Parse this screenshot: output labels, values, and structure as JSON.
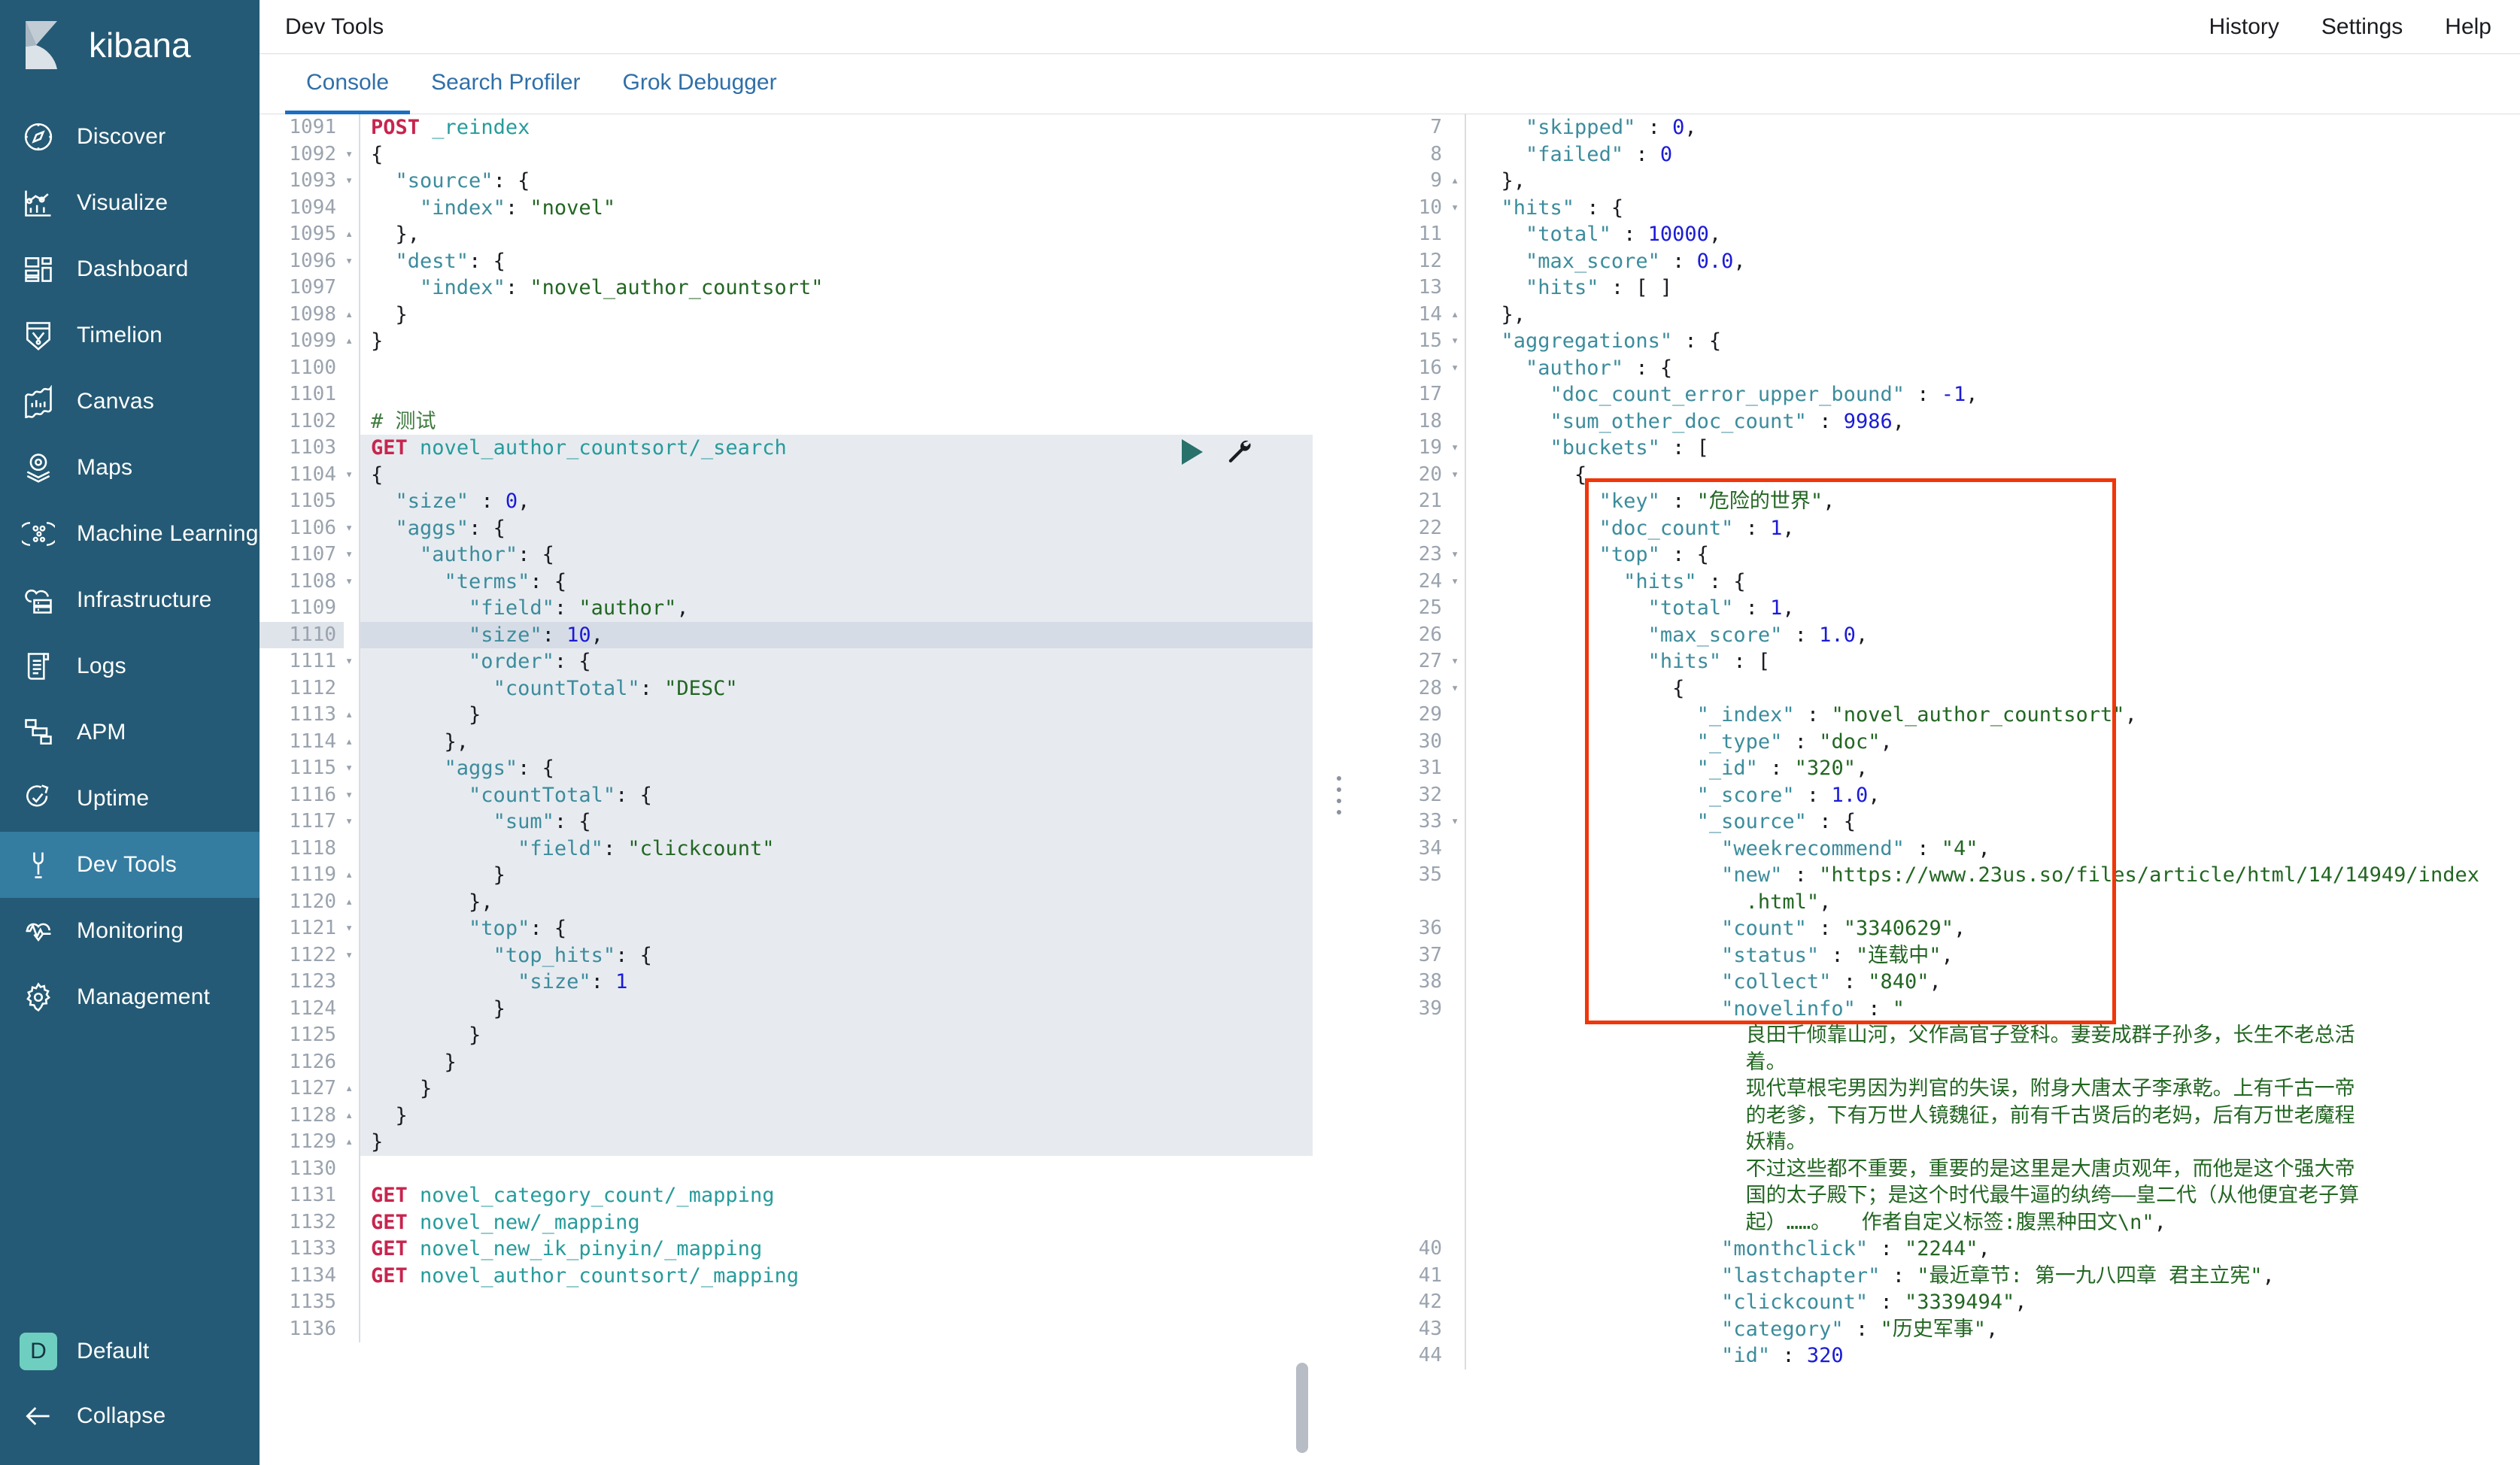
{
  "app": {
    "brand": "kibana",
    "page_title": "Dev Tools"
  },
  "topbar": {
    "links": [
      "History",
      "Settings",
      "Help"
    ]
  },
  "tabs": [
    {
      "label": "Console",
      "active": true
    },
    {
      "label": "Search Profiler",
      "active": false
    },
    {
      "label": "Grok Debugger",
      "active": false
    }
  ],
  "sidebar": {
    "items": [
      {
        "label": "Discover",
        "icon": "compass-icon",
        "active": false
      },
      {
        "label": "Visualize",
        "icon": "bar-chart-icon",
        "active": false
      },
      {
        "label": "Dashboard",
        "icon": "dashboard-icon",
        "active": false
      },
      {
        "label": "Timelion",
        "icon": "timelion-icon",
        "active": false
      },
      {
        "label": "Canvas",
        "icon": "canvas-icon",
        "active": false
      },
      {
        "label": "Maps",
        "icon": "map-pin-icon",
        "active": false
      },
      {
        "label": "Machine Learning",
        "icon": "machine-learning-icon",
        "active": false
      },
      {
        "label": "Infrastructure",
        "icon": "infrastructure-icon",
        "active": false
      },
      {
        "label": "Logs",
        "icon": "logs-icon",
        "active": false
      },
      {
        "label": "APM",
        "icon": "apm-icon",
        "active": false
      },
      {
        "label": "Uptime",
        "icon": "uptime-icon",
        "active": false
      },
      {
        "label": "Dev Tools",
        "icon": "wrench-icon",
        "active": true
      },
      {
        "label": "Monitoring",
        "icon": "heartbeat-icon",
        "active": false
      },
      {
        "label": "Management",
        "icon": "gear-icon",
        "active": false
      }
    ],
    "space": {
      "initial": "D",
      "label": "Default"
    },
    "collapse": {
      "label": "Collapse",
      "icon": "arrow-left-icon"
    }
  },
  "colors": {
    "sidebar_bg": "#245a75",
    "sidebar_active": "#357ca1",
    "tab_active": "#1b6ec2",
    "accent_link": "#2f6fa8",
    "avatar": "#6ecfc0",
    "annotation": "#f0360a",
    "method": "#c7254e",
    "url": "#279b9b",
    "key": "#3c8c9c",
    "string": "#226622",
    "number": "#1b1bd6",
    "comment": "#3f7a3f"
  },
  "editor": {
    "first_line_number": 1091,
    "cursor_line": 1110,
    "lines": [
      {
        "n": 1091,
        "fold": "",
        "hl": false,
        "html": "<span class=\"m\">POST</span> <span class=\"u\">_reindex</span>"
      },
      {
        "n": 1092,
        "fold": "▾",
        "hl": false,
        "html": "<span class=\"p\">{</span>"
      },
      {
        "n": 1093,
        "fold": "▾",
        "hl": false,
        "html": "  <span class=\"k\">\"source\"</span><span class=\"p\">: {</span>"
      },
      {
        "n": 1094,
        "fold": "",
        "hl": false,
        "html": "    <span class=\"k\">\"index\"</span><span class=\"p\">: </span><span class=\"s\">\"novel\"</span>"
      },
      {
        "n": 1095,
        "fold": "▴",
        "hl": false,
        "html": "  <span class=\"p\">},</span>"
      },
      {
        "n": 1096,
        "fold": "▾",
        "hl": false,
        "html": "  <span class=\"k\">\"dest\"</span><span class=\"p\">: {</span>"
      },
      {
        "n": 1097,
        "fold": "",
        "hl": false,
        "html": "    <span class=\"k\">\"index\"</span><span class=\"p\">: </span><span class=\"s\">\"novel_author_countsort\"</span>"
      },
      {
        "n": 1098,
        "fold": "▴",
        "hl": false,
        "html": "  <span class=\"p\">}</span>"
      },
      {
        "n": 1099,
        "fold": "▴",
        "hl": false,
        "html": "<span class=\"p\">}</span>"
      },
      {
        "n": 1100,
        "fold": "",
        "hl": false,
        "html": ""
      },
      {
        "n": 1101,
        "fold": "",
        "hl": false,
        "html": ""
      },
      {
        "n": 1102,
        "fold": "",
        "hl": false,
        "html": "<span class=\"cm\"># 测试</span>"
      },
      {
        "n": 1103,
        "fold": "",
        "hl": true,
        "html": "<span class=\"m\">GET</span> <span class=\"u\">novel_author_countsort/_search</span>"
      },
      {
        "n": 1104,
        "fold": "▾",
        "hl": true,
        "html": "<span class=\"p\">{</span>"
      },
      {
        "n": 1105,
        "fold": "",
        "hl": true,
        "html": "  <span class=\"k\">\"size\"</span> <span class=\"p\">: </span><span class=\"n\">0</span><span class=\"p\">,</span>"
      },
      {
        "n": 1106,
        "fold": "▾",
        "hl": true,
        "html": "  <span class=\"k\">\"aggs\"</span><span class=\"p\">: {</span>"
      },
      {
        "n": 1107,
        "fold": "▾",
        "hl": true,
        "html": "    <span class=\"k\">\"author\"</span><span class=\"p\">: {</span>"
      },
      {
        "n": 1108,
        "fold": "▾",
        "hl": true,
        "html": "      <span class=\"k\">\"terms\"</span><span class=\"p\">: {</span>"
      },
      {
        "n": 1109,
        "fold": "",
        "hl": true,
        "html": "        <span class=\"k\">\"field\"</span><span class=\"p\">: </span><span class=\"s\">\"author\"</span><span class=\"p\">,</span>"
      },
      {
        "n": 1110,
        "fold": "",
        "hl": true,
        "cursor": true,
        "html": "        <span class=\"k\">\"size\"</span><span class=\"p\">: </span><span class=\"n\">10</span><span class=\"p\">,</span>"
      },
      {
        "n": 1111,
        "fold": "▾",
        "hl": true,
        "html": "        <span class=\"k\">\"order\"</span><span class=\"p\">: {</span>"
      },
      {
        "n": 1112,
        "fold": "",
        "hl": true,
        "html": "          <span class=\"k\">\"countTotal\"</span><span class=\"p\">: </span><span class=\"s\">\"DESC\"</span>"
      },
      {
        "n": 1113,
        "fold": "▴",
        "hl": true,
        "html": "        <span class=\"p\">}</span>"
      },
      {
        "n": 1114,
        "fold": "▴",
        "hl": true,
        "html": "      <span class=\"p\">},</span>"
      },
      {
        "n": 1115,
        "fold": "▾",
        "hl": true,
        "html": "      <span class=\"k\">\"aggs\"</span><span class=\"p\">: {</span>"
      },
      {
        "n": 1116,
        "fold": "▾",
        "hl": true,
        "html": "        <span class=\"k\">\"countTotal\"</span><span class=\"p\">: {</span>"
      },
      {
        "n": 1117,
        "fold": "▾",
        "hl": true,
        "html": "          <span class=\"k\">\"sum\"</span><span class=\"p\">: {</span>"
      },
      {
        "n": 1118,
        "fold": "",
        "hl": true,
        "html": "            <span class=\"k\">\"field\"</span><span class=\"p\">: </span><span class=\"s\">\"clickcount\"</span>"
      },
      {
        "n": 1119,
        "fold": "▴",
        "hl": true,
        "html": "          <span class=\"p\">}</span>"
      },
      {
        "n": 1120,
        "fold": "▴",
        "hl": true,
        "html": "        <span class=\"p\">},</span>"
      },
      {
        "n": 1121,
        "fold": "▾",
        "hl": true,
        "html": "        <span class=\"k\">\"top\"</span><span class=\"p\">: {</span>"
      },
      {
        "n": 1122,
        "fold": "▾",
        "hl": true,
        "html": "          <span class=\"k\">\"top_hits\"</span><span class=\"p\">: {</span>"
      },
      {
        "n": 1123,
        "fold": "",
        "hl": true,
        "html": "            <span class=\"k\">\"size\"</span><span class=\"p\">: </span><span class=\"n\">1</span>"
      },
      {
        "n": 1124,
        "fold": "",
        "hl": true,
        "html": "          <span class=\"p\">}</span>"
      },
      {
        "n": 1125,
        "fold": "",
        "hl": true,
        "html": "        <span class=\"p\">}</span>"
      },
      {
        "n": 1126,
        "fold": "",
        "hl": true,
        "html": "      <span class=\"p\">}</span>"
      },
      {
        "n": 1127,
        "fold": "▴",
        "hl": true,
        "html": "    <span class=\"p\">}</span>"
      },
      {
        "n": 1128,
        "fold": "▴",
        "hl": true,
        "html": "  <span class=\"p\">}</span>"
      },
      {
        "n": 1129,
        "fold": "▴",
        "hl": true,
        "html": "<span class=\"p\">}</span>"
      },
      {
        "n": 1130,
        "fold": "",
        "hl": false,
        "html": ""
      },
      {
        "n": 1131,
        "fold": "",
        "hl": false,
        "html": "<span class=\"m\">GET</span> <span class=\"u\">novel_category_count/_mapping</span>"
      },
      {
        "n": 1132,
        "fold": "",
        "hl": false,
        "html": "<span class=\"m\">GET</span> <span class=\"u\">novel_new/_mapping</span>"
      },
      {
        "n": 1133,
        "fold": "",
        "hl": false,
        "html": "<span class=\"m\">GET</span> <span class=\"u\">novel_new_ik_pinyin/_mapping</span>"
      },
      {
        "n": 1134,
        "fold": "",
        "hl": false,
        "html": "<span class=\"m\">GET</span> <span class=\"u\">novel_author_countsort/_mapping</span>"
      },
      {
        "n": 1135,
        "fold": "",
        "hl": false,
        "html": ""
      },
      {
        "n": 1136,
        "fold": "",
        "hl": false,
        "html": ""
      }
    ],
    "toolbar": {
      "play": "play-icon",
      "wrench": "wrench-icon",
      "on_line": 1103
    }
  },
  "response": {
    "first_line_number": 7,
    "lines": [
      {
        "n": 7,
        "fold": "",
        "html": "    <span class=\"k\">\"skipped\"</span> <span class=\"p\">: </span><span class=\"n\">0</span><span class=\"p\">,</span>"
      },
      {
        "n": 8,
        "fold": "",
        "html": "    <span class=\"k\">\"failed\"</span> <span class=\"p\">: </span><span class=\"n\">0</span>"
      },
      {
        "n": 9,
        "fold": "▴",
        "html": "  <span class=\"p\">},</span>"
      },
      {
        "n": 10,
        "fold": "▾",
        "html": "  <span class=\"k\">\"hits\"</span> <span class=\"p\">: {</span>"
      },
      {
        "n": 11,
        "fold": "",
        "html": "    <span class=\"k\">\"total\"</span> <span class=\"p\">: </span><span class=\"n\">10000</span><span class=\"p\">,</span>"
      },
      {
        "n": 12,
        "fold": "",
        "html": "    <span class=\"k\">\"max_score\"</span> <span class=\"p\">: </span><span class=\"n\">0.0</span><span class=\"p\">,</span>"
      },
      {
        "n": 13,
        "fold": "",
        "html": "    <span class=\"k\">\"hits\"</span> <span class=\"p\">: [ ]</span>"
      },
      {
        "n": 14,
        "fold": "▴",
        "html": "  <span class=\"p\">},</span>"
      },
      {
        "n": 15,
        "fold": "▾",
        "html": "  <span class=\"k\">\"aggregations\"</span> <span class=\"p\">: {</span>"
      },
      {
        "n": 16,
        "fold": "▾",
        "html": "    <span class=\"k\">\"author\"</span> <span class=\"p\">: {</span>"
      },
      {
        "n": 17,
        "fold": "",
        "html": "      <span class=\"k\">\"doc_count_error_upper_bound\"</span> <span class=\"p\">: </span><span class=\"n\">-1</span><span class=\"p\">,</span>"
      },
      {
        "n": 18,
        "fold": "",
        "html": "      <span class=\"k\">\"sum_other_doc_count\"</span> <span class=\"p\">: </span><span class=\"n\">9986</span><span class=\"p\">,</span>"
      },
      {
        "n": 19,
        "fold": "▾",
        "html": "      <span class=\"k\">\"buckets\"</span> <span class=\"p\">: [</span>"
      },
      {
        "n": 20,
        "fold": "▾",
        "html": "        <span class=\"p\">{</span>"
      },
      {
        "n": 21,
        "fold": "",
        "html": "          <span class=\"k\">\"key\"</span> <span class=\"p\">: </span><span class=\"s\">\"危险的世界\"</span><span class=\"p\">,</span>"
      },
      {
        "n": 22,
        "fold": "",
        "html": "          <span class=\"k\">\"doc_count\"</span> <span class=\"p\">: </span><span class=\"n\">1</span><span class=\"p\">,</span>"
      },
      {
        "n": 23,
        "fold": "▾",
        "html": "          <span class=\"k\">\"top\"</span> <span class=\"p\">: {</span>"
      },
      {
        "n": 24,
        "fold": "▾",
        "html": "            <span class=\"k\">\"hits\"</span> <span class=\"p\">: {</span>"
      },
      {
        "n": 25,
        "fold": "",
        "html": "              <span class=\"k\">\"total\"</span> <span class=\"p\">: </span><span class=\"n\">1</span><span class=\"p\">,</span>"
      },
      {
        "n": 26,
        "fold": "",
        "html": "              <span class=\"k\">\"max_score\"</span> <span class=\"p\">: </span><span class=\"n\">1.0</span><span class=\"p\">,</span>"
      },
      {
        "n": 27,
        "fold": "▾",
        "html": "              <span class=\"k\">\"hits\"</span> <span class=\"p\">: [</span>"
      },
      {
        "n": 28,
        "fold": "▾",
        "html": "                <span class=\"p\">{</span>"
      },
      {
        "n": 29,
        "fold": "",
        "html": "                  <span class=\"k\">\"_index\"</span> <span class=\"p\">: </span><span class=\"s\">\"novel_author_countsort\"</span><span class=\"p\">,</span>"
      },
      {
        "n": 30,
        "fold": "",
        "html": "                  <span class=\"k\">\"_type\"</span> <span class=\"p\">: </span><span class=\"s\">\"doc\"</span><span class=\"p\">,</span>"
      },
      {
        "n": 31,
        "fold": "",
        "html": "                  <span class=\"k\">\"_id\"</span> <span class=\"p\">: </span><span class=\"s\">\"320\"</span><span class=\"p\">,</span>"
      },
      {
        "n": 32,
        "fold": "",
        "html": "                  <span class=\"k\">\"_score\"</span> <span class=\"p\">: </span><span class=\"n\">1.0</span><span class=\"p\">,</span>"
      },
      {
        "n": 33,
        "fold": "▾",
        "html": "                  <span class=\"k\">\"_source\"</span> <span class=\"p\">: {</span>"
      },
      {
        "n": 34,
        "fold": "",
        "html": "                    <span class=\"k\">\"weekrecommend\"</span> <span class=\"p\">: </span><span class=\"s\">\"4\"</span><span class=\"p\">,</span>"
      },
      {
        "n": 35,
        "fold": "",
        "wrapLines": [
          "                    <span class=\"k\">\"new\"</span> <span class=\"p\">: </span><span class=\"s\">\"https://www.23us.so/files/article/html/14/14949/index</span>",
          "                      <span class=\"s\">.html\"</span><span class=\"p\">,</span>"
        ]
      },
      {
        "n": 36,
        "fold": "",
        "html": "                    <span class=\"k\">\"count\"</span> <span class=\"p\">: </span><span class=\"s\">\"3340629\"</span><span class=\"p\">,</span>"
      },
      {
        "n": 37,
        "fold": "",
        "html": "                    <span class=\"k\">\"status\"</span> <span class=\"p\">: </span><span class=\"s\">\"连载中\"</span><span class=\"p\">,</span>"
      },
      {
        "n": 38,
        "fold": "",
        "html": "                    <span class=\"k\">\"collect\"</span> <span class=\"p\">: </span><span class=\"s\">\"840\"</span><span class=\"p\">,</span>"
      },
      {
        "n": 39,
        "fold": "",
        "wrapLines": [
          "                    <span class=\"k\">\"novelinfo\"</span> <span class=\"p\">: </span><span class=\"s\">\"</span>",
          "                      <span class=\"s\">良田千倾靠山河，父作高官子登科。妻妾成群子孙多，长生不老总活</span>",
          "                      <span class=\"s\">着。</span>",
          "                      <span class=\"s\">现代草根宅男因为判官的失误，附身大唐太子李承乾。上有千古一帝</span>",
          "                      <span class=\"s\">的老爹，下有万世人镜魏征，前有千古贤后的老妈，后有万世老魔程</span>",
          "                      <span class=\"s\">妖精。</span>",
          "                      <span class=\"s\">不过这些都不重要，重要的是这里是大唐贞观年，而他是这个强大帝</span>",
          "                      <span class=\"s\">国的太子殿下；是这个时代最牛逼的纨绔——皇二代（从他便宜老子算</span>",
          "                      <span class=\"s\">起）……。　　作者自定义标签:腹黑种田文\\n\"</span><span class=\"p\">,</span>"
        ]
      },
      {
        "n": 40,
        "fold": "",
        "html": "                    <span class=\"k\">\"monthclick\"</span> <span class=\"p\">: </span><span class=\"s\">\"2244\"</span><span class=\"p\">,</span>"
      },
      {
        "n": 41,
        "fold": "",
        "html": "                    <span class=\"k\">\"lastchapter\"</span> <span class=\"p\">: </span><span class=\"s\">\"最近章节: 第一九八四章 君主立宪\"</span><span class=\"p\">,</span>"
      },
      {
        "n": 42,
        "fold": "",
        "html": "                    <span class=\"k\">\"clickcount\"</span> <span class=\"p\">: </span><span class=\"s\">\"3339494\"</span><span class=\"p\">,</span>"
      },
      {
        "n": 43,
        "fold": "",
        "html": "                    <span class=\"k\">\"category\"</span> <span class=\"p\">: </span><span class=\"s\">\"历史军事\"</span><span class=\"p\">,</span>"
      },
      {
        "n": 44,
        "fold": "",
        "html": "                    <span class=\"k\">\"id\"</span> <span class=\"p\">: </span><span class=\"n\">320</span>"
      }
    ]
  },
  "annotation": {
    "shape": "rectangle",
    "color": "#f0360a",
    "covers": "bucket-object-lines-20-to-39"
  }
}
